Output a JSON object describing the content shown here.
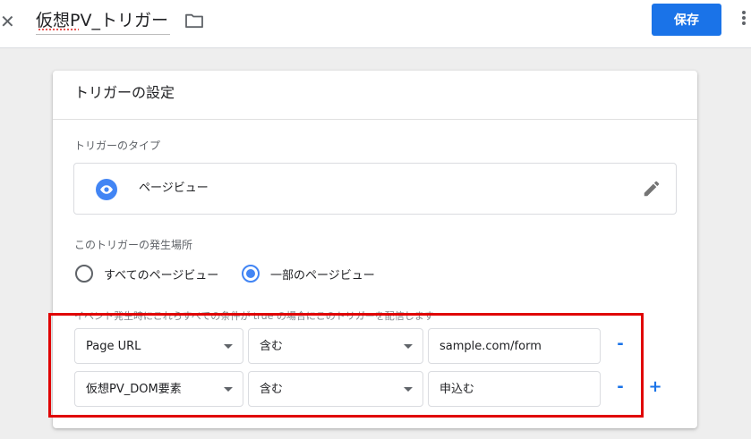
{
  "header": {
    "title": "仮想PV_トリガー",
    "save_label": "保存",
    "close_icon": "close-icon",
    "folder_icon": "folder-icon",
    "more_icon": "more-vert-icon"
  },
  "card": {
    "title": "トリガーの設定",
    "type_section_label": "トリガーのタイプ",
    "type_name": "ページビュー",
    "type_icon": "eye-icon",
    "edit_icon": "pencil-icon",
    "fire_section_label": "このトリガーの発生場所",
    "radio_options": [
      {
        "label": "すべてのページビュー",
        "checked": false
      },
      {
        "label": "一部のページビュー",
        "checked": true
      }
    ],
    "conditions_label": "イベント発生時にこれらすべての条件が true の場合にこのトリガーを配信します",
    "conditions": [
      {
        "variable": "Page URL",
        "operator": "含む",
        "value": "sample.com/form",
        "remove_label": "-",
        "add_label": ""
      },
      {
        "variable": "仮想PV_DOM要素",
        "operator": "含む",
        "value": "申込む",
        "remove_label": "-",
        "add_label": "+"
      }
    ]
  },
  "colors": {
    "accent": "#1a73e8",
    "highlight": "#e00000"
  }
}
